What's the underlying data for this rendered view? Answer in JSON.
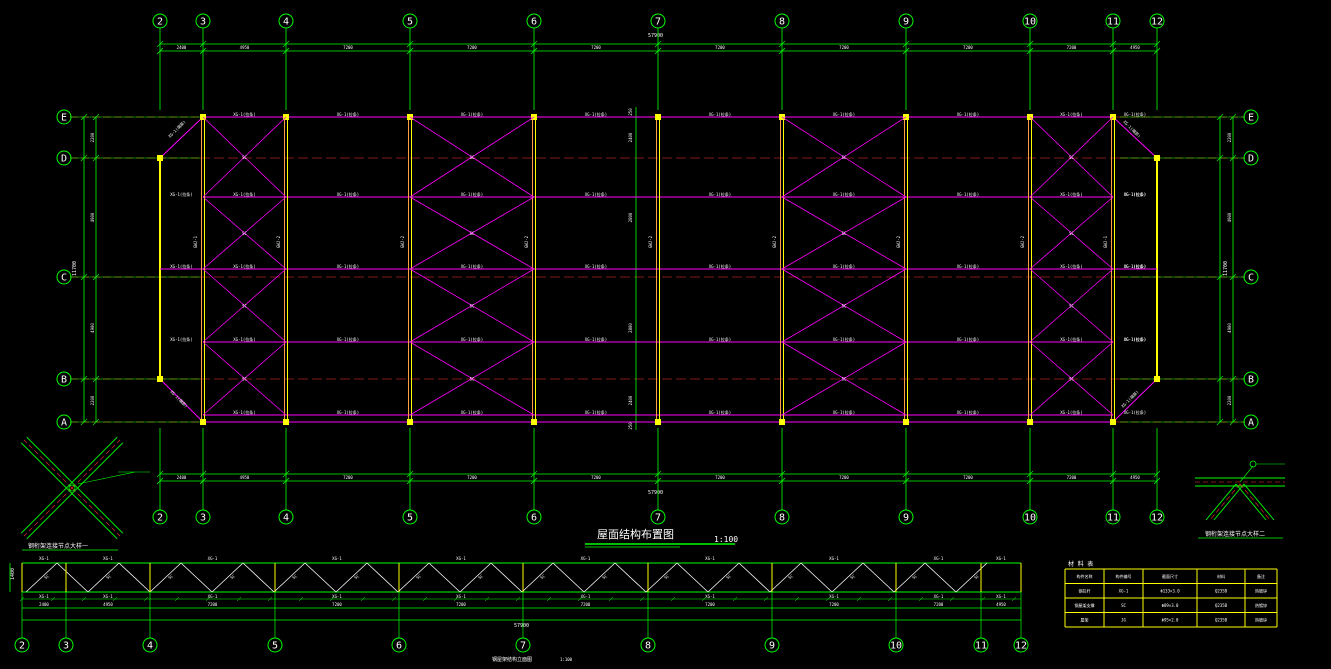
{
  "drawing": {
    "title": "屋面结构布置图",
    "scale": "1:100",
    "truss_title": "钢屋架结构立面图",
    "truss_scale": "1:100",
    "detail1_label": "钢桁架连接节点大样一",
    "detail2_label": "钢桁架连接节点大样二"
  },
  "axes_x": [
    "2",
    "3",
    "4",
    "5",
    "6",
    "7",
    "8",
    "9",
    "10",
    "11",
    "12"
  ],
  "axes_y": [
    "E",
    "D",
    "C",
    "B",
    "A"
  ],
  "dims_top": [
    "2400",
    "4950",
    "7200",
    "7200",
    "7200",
    "7200",
    "7200",
    "7200",
    "7200",
    "4950",
    "2400"
  ],
  "dims_bottom": [
    "2400",
    "4950",
    "7200",
    "7200",
    "7200",
    "7200",
    "7200",
    "7200",
    "7200",
    "4950",
    "2400"
  ],
  "overall_dim": "57900",
  "side_dims_left": [
    "2200",
    "4900",
    "4900",
    "2200"
  ],
  "side_total_left": "11700",
  "side_dims_right": [
    "2200",
    "4900",
    "4900",
    "2200"
  ],
  "side_total_right": "11700",
  "center_dims": [
    "250",
    "2400",
    "2800",
    "2800",
    "2400",
    "250"
  ],
  "member_labels": {
    "purlin": "XG-1(拉条)",
    "brace": "SC",
    "tie_end": "XG-1(端部)",
    "truss_main": "GWJ-2",
    "truss_end": "GWJ-1"
  },
  "truss_elevation": {
    "height": "1400",
    "top_label": "XG-1",
    "diag_label": "SC",
    "bay_dims": [
      "2400",
      "4950",
      "7200",
      "7200",
      "7200",
      "7200",
      "7200",
      "7200",
      "7200",
      "4950",
      "2400"
    ],
    "overall": "57900"
  },
  "material_table": {
    "caption": "材 料 表",
    "headers": [
      "构件名称",
      "构件编号",
      "截面尺寸",
      "材料",
      "备注"
    ],
    "rows": [
      [
        "钢拉杆",
        "XG-1",
        "Φ133×3.0",
        "Q235B",
        "热镀锌"
      ],
      [
        "钢屋架支撑",
        "SC",
        "Φ89×3.0",
        "Q235B",
        "热镀锌"
      ],
      [
        "屋架",
        "JG",
        "Φ95×2.0",
        "Q235B",
        "热镀锌"
      ]
    ]
  },
  "colors": {
    "grid": "#00ff00",
    "dashed": "#ff3030",
    "member": "#ff00ff",
    "column": "#ffff00",
    "beam": "#ffa040",
    "text": "#ffffff"
  }
}
